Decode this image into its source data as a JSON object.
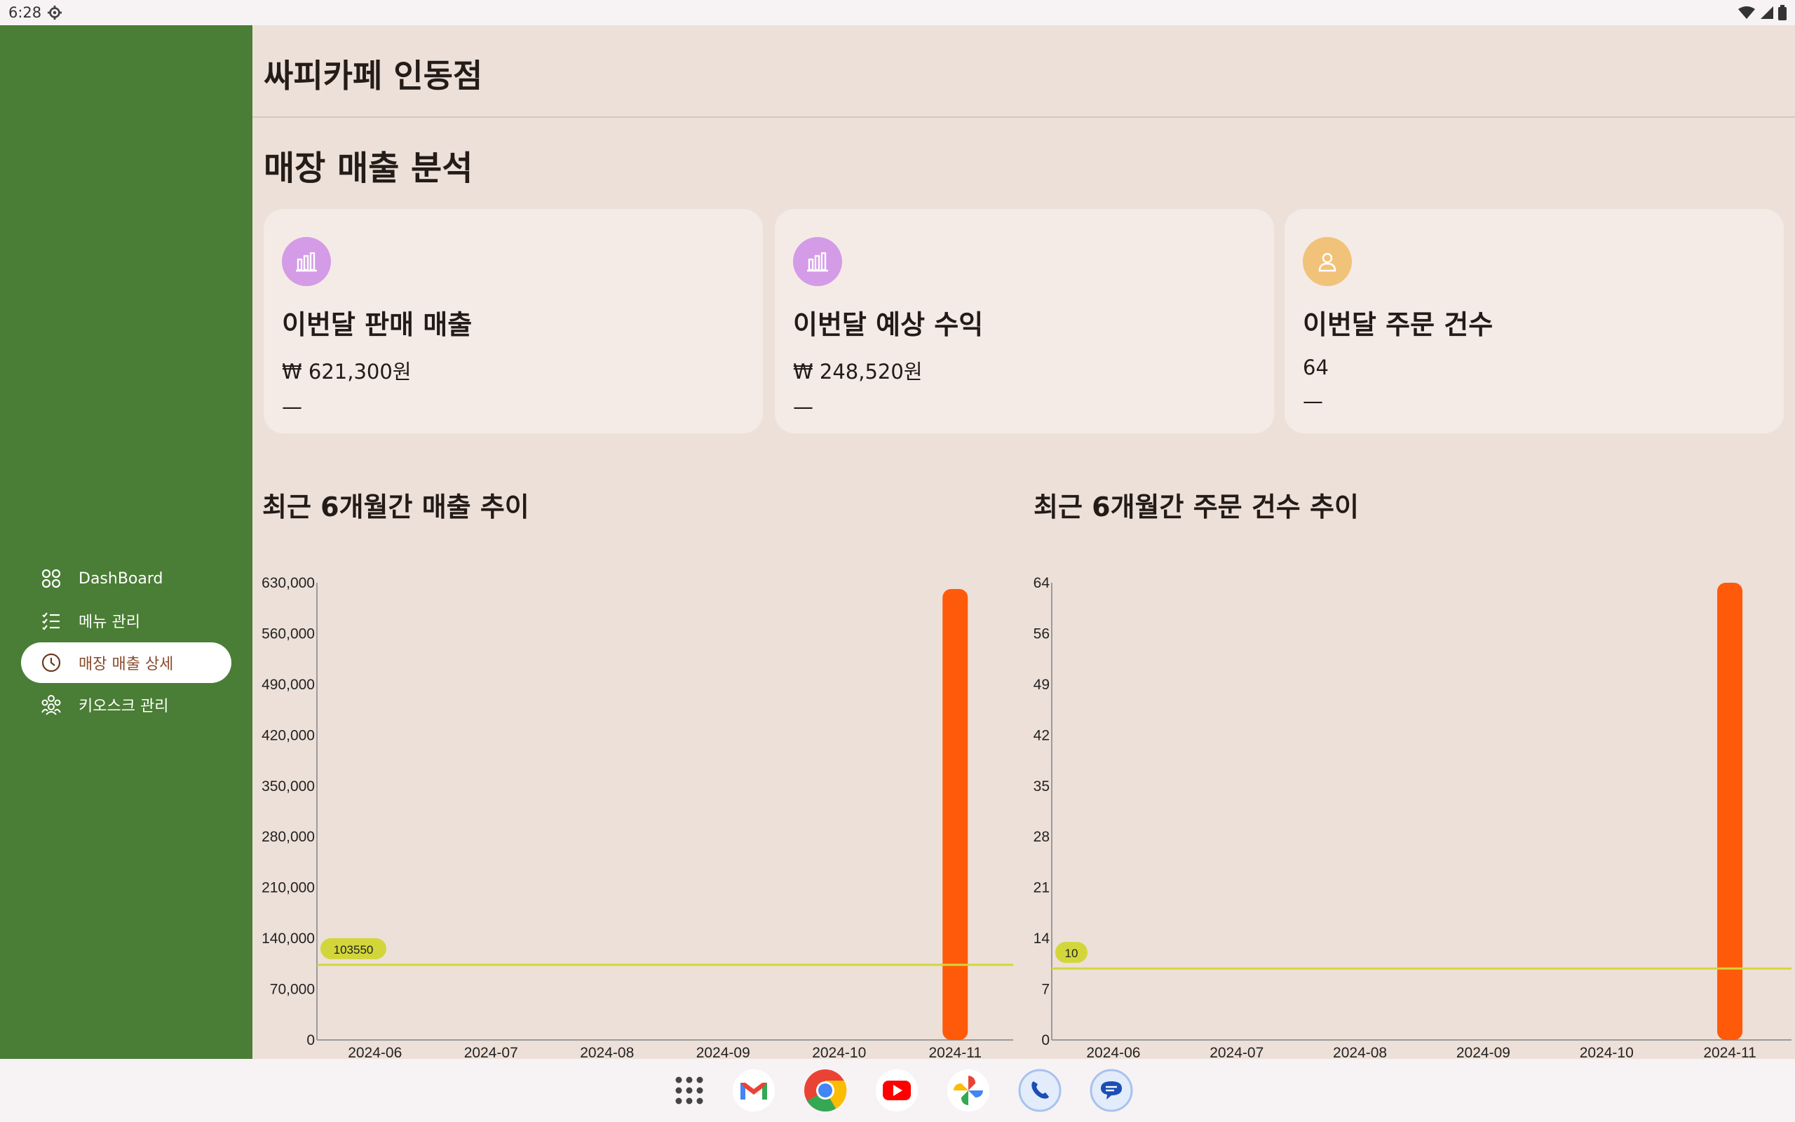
{
  "status_bar": {
    "time": "6:28"
  },
  "sidebar": {
    "items": [
      {
        "label": "DashBoard",
        "icon": "grid-icon",
        "active": false
      },
      {
        "label": "메뉴 관리",
        "icon": "checklist-icon",
        "active": false
      },
      {
        "label": "매장 매출 상세",
        "icon": "clock-icon",
        "active": true
      },
      {
        "label": "키오스크 관리",
        "icon": "people-icon",
        "active": false
      }
    ]
  },
  "header": {
    "store_name": "싸피카페 인동점"
  },
  "section": {
    "title": "매장 매출 분석"
  },
  "cards": [
    {
      "title": "이번달 판매 매출",
      "value": "₩ 621,300원",
      "change": "—",
      "icon": "bar-chart-icon",
      "icon_color": "#d49be6"
    },
    {
      "title": "이번달 예상 수익",
      "value": "₩ 248,520원",
      "change": "—",
      "icon": "bar-chart-icon",
      "icon_color": "#d49be6"
    },
    {
      "title": "이번달 주문 건수",
      "value": "64",
      "change": "—",
      "icon": "person-icon",
      "icon_color": "#f1c27a"
    }
  ],
  "colors": {
    "sidebar": "#4a7d35",
    "background": "#ede0d8",
    "bar": "#ff5a0a",
    "average_line": "#d3d63a",
    "active_text": "#8a4a2a"
  },
  "chart_data": [
    {
      "type": "bar",
      "title": "최근 6개월간 매출 추이",
      "categories": [
        "2024-06",
        "2024-07",
        "2024-08",
        "2024-09",
        "2024-10",
        "2024-11"
      ],
      "values": [
        0,
        0,
        0,
        0,
        0,
        621300
      ],
      "y_ticks": [
        "0",
        "70,000",
        "140,000",
        "210,000",
        "280,000",
        "350,000",
        "420,000",
        "490,000",
        "560,000",
        "630,000"
      ],
      "ylim": [
        0,
        630000
      ],
      "average": 103550,
      "average_label": "103550"
    },
    {
      "type": "bar",
      "title": "최근 6개월간 주문 건수 추이",
      "categories": [
        "2024-06",
        "2024-07",
        "2024-08",
        "2024-09",
        "2024-10",
        "2024-11"
      ],
      "values": [
        0,
        0,
        0,
        0,
        0,
        64
      ],
      "y_ticks": [
        "0",
        "7",
        "14",
        "21",
        "28",
        "35",
        "42",
        "49",
        "56",
        "64"
      ],
      "ylim": [
        0,
        64
      ],
      "average": 10,
      "average_label": "10"
    }
  ],
  "dock": {
    "apps": [
      {
        "name": "app-drawer"
      },
      {
        "name": "gmail"
      },
      {
        "name": "chrome"
      },
      {
        "name": "youtube"
      },
      {
        "name": "photos"
      },
      {
        "name": "phone"
      },
      {
        "name": "messages"
      }
    ]
  }
}
